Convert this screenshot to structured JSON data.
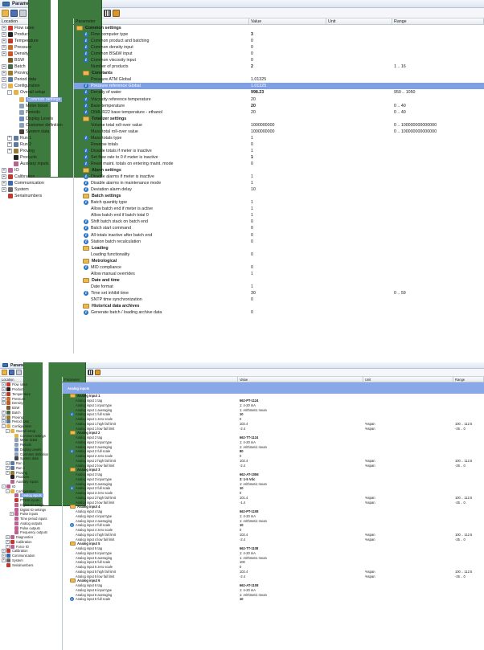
{
  "window": {
    "title": "Parameters"
  },
  "columns": {
    "location": "Location",
    "parameter": "Parameter",
    "value": "Value",
    "unit": "Unit",
    "range": "Range"
  },
  "toolbar": [
    "folder-open-icon",
    "save-icon",
    "print-icon",
    "tree-view-icon",
    "columns-icon",
    "filter-icon"
  ],
  "tree1": [
    {
      "label": "Flow rates",
      "lvl": 0,
      "exp": "+",
      "icon": "#d43a2f"
    },
    {
      "label": "Product",
      "lvl": 0,
      "exp": "+",
      "icon": "#222222"
    },
    {
      "label": "Temperature",
      "lvl": 0,
      "exp": "+",
      "icon": "#c0392b"
    },
    {
      "label": "Pressure",
      "lvl": 0,
      "exp": "+",
      "icon": "#c66f2b"
    },
    {
      "label": "Density",
      "lvl": 0,
      "exp": "+",
      "icon": "#c45a2a"
    },
    {
      "label": "BSW",
      "lvl": 0,
      "exp": "",
      "icon": "#7a5a2a"
    },
    {
      "label": "Batch",
      "lvl": 0,
      "exp": "+",
      "icon": "#4a6a4a"
    },
    {
      "label": "Proving",
      "lvl": 0,
      "exp": "+",
      "icon": "#9a7a30"
    },
    {
      "label": "Period data",
      "lvl": 0,
      "exp": "+",
      "icon": "#5a7a9a"
    },
    {
      "label": "Configuration",
      "lvl": 0,
      "exp": "-",
      "icon": "#e5b24a"
    },
    {
      "label": "Overall setup",
      "lvl": 1,
      "exp": "-",
      "icon": "#e5b24a"
    },
    {
      "label": "Common settings",
      "lvl": 2,
      "exp": "",
      "icon": "#e5b24a",
      "sel": true
    },
    {
      "label": "Meter ticket",
      "lvl": 2,
      "exp": "",
      "icon": "#8aa0b8"
    },
    {
      "label": "Periods",
      "lvl": 2,
      "exp": "",
      "icon": "#8aa0b8"
    },
    {
      "label": "Display Levels",
      "lvl": 2,
      "exp": "",
      "icon": "#6a8ac0"
    },
    {
      "label": "Customer definition",
      "lvl": 2,
      "exp": "",
      "icon": "#8aa0b8"
    },
    {
      "label": "System data",
      "lvl": 2,
      "exp": "",
      "icon": "#444444"
    },
    {
      "label": "Run 1",
      "lvl": 1,
      "exp": "+",
      "icon": "#5a7aa0"
    },
    {
      "label": "Run 2",
      "lvl": 1,
      "exp": "+",
      "icon": "#5a7aa0"
    },
    {
      "label": "Proving",
      "lvl": 1,
      "exp": "+",
      "icon": "#9a7a30"
    },
    {
      "label": "Products",
      "lvl": 1,
      "exp": "",
      "icon": "#222222"
    },
    {
      "label": "Auxiliary inputs",
      "lvl": 1,
      "exp": "",
      "icon": "#c06090"
    },
    {
      "label": "IO",
      "lvl": 0,
      "exp": "+",
      "icon": "#c06090"
    },
    {
      "label": "Calibration",
      "lvl": 0,
      "exp": "+",
      "icon": "#c0392b"
    },
    {
      "label": "Communication",
      "lvl": 0,
      "exp": "+",
      "icon": "#3a6ab0"
    },
    {
      "label": "System",
      "lvl": 0,
      "exp": "+",
      "icon": "#666666"
    },
    {
      "label": "Serialnumbers",
      "lvl": 0,
      "exp": "",
      "icon": "#c0392b"
    }
  ],
  "rows1": [
    {
      "t": "banner1",
      "p": "Common settings"
    },
    {
      "t": "i",
      "p": "Flow computer type",
      "v": "3",
      "b": true
    },
    {
      "t": "i",
      "p": "Common product and batching",
      "v": "0"
    },
    {
      "t": "i",
      "p": "Common density input",
      "v": "0"
    },
    {
      "t": "i",
      "p": "Common BS&W input",
      "v": "0"
    },
    {
      "t": "i",
      "p": "Common viscosity input",
      "v": "0"
    },
    {
      "t": "n",
      "p": "Number of products",
      "v": "2",
      "b": true,
      "r": "1 .. 16"
    },
    {
      "t": "s",
      "p": "Constants"
    },
    {
      "t": "n",
      "p": "Pressure ATM Global",
      "v": "1.01325"
    },
    {
      "t": "i",
      "p": "Pressure reference Global",
      "v": "1.01325",
      "sel": true
    },
    {
      "t": "i",
      "p": "Density of water",
      "v": "998.23",
      "b": true,
      "r": "950 .. 1050"
    },
    {
      "t": "i",
      "p": "Viscosity reference temperature",
      "v": "20"
    },
    {
      "t": "i",
      "p": "Base temperature",
      "v": "20",
      "b": true,
      "r": "0 .. 40"
    },
    {
      "t": "i",
      "p": "OIML R22 base temperature - ethanol",
      "v": "20",
      "r": "0 .. 40"
    },
    {
      "t": "s",
      "p": "Totalizer settings"
    },
    {
      "t": "n",
      "p": "Volume total roll-over value",
      "v": "1000000000",
      "r": "0 .. 100000000000000"
    },
    {
      "t": "n",
      "p": "Mass total roll-over value",
      "v": "1000000000",
      "r": "0 .. 100000000000000"
    },
    {
      "t": "i",
      "p": "Mass totals type",
      "v": "1"
    },
    {
      "t": "n",
      "p": "Reverse totals",
      "v": "0"
    },
    {
      "t": "i",
      "p": "Disable totals if meter is inactive",
      "v": "1"
    },
    {
      "t": "i",
      "p": "Set flow rate to 0 if meter is inactive",
      "v": "1",
      "b": true
    },
    {
      "t": "i",
      "p": "Reset maint. totals on entering maint. mode",
      "v": "0"
    },
    {
      "t": "s",
      "p": "Alarm settings"
    },
    {
      "t": "i",
      "p": "Disable alarms if meter is inactive",
      "v": "1"
    },
    {
      "t": "i",
      "p": "Disable alarms in maintenance mode",
      "v": "1"
    },
    {
      "t": "i",
      "p": "Deviation alarm delay",
      "v": "10"
    },
    {
      "t": "s",
      "p": "Batch settings"
    },
    {
      "t": "i",
      "p": "Batch quantity type",
      "v": "1"
    },
    {
      "t": "n",
      "p": "Allow batch end if meter is active",
      "v": "1"
    },
    {
      "t": "n",
      "p": "Allow batch end if batch total 0",
      "v": "1"
    },
    {
      "t": "i",
      "p": "Shift batch stack on batch end",
      "v": "0"
    },
    {
      "t": "i",
      "p": "Batch start command",
      "v": "0"
    },
    {
      "t": "i",
      "p": "All totals inactive after batch end",
      "v": "0"
    },
    {
      "t": "i",
      "p": "Station batch recalculation",
      "v": "0"
    },
    {
      "t": "s",
      "p": "Loading"
    },
    {
      "t": "n",
      "p": "Loading functionality",
      "v": "0"
    },
    {
      "t": "s",
      "p": "Metrological"
    },
    {
      "t": "i",
      "p": "MID compliance",
      "v": "0"
    },
    {
      "t": "n",
      "p": "Allow manual overrides",
      "v": "1"
    },
    {
      "t": "s",
      "p": "Date and time"
    },
    {
      "t": "n",
      "p": "Date format",
      "v": "1"
    },
    {
      "t": "i",
      "p": "Time set inhibit time",
      "v": "30",
      "r": "0 .. 59"
    },
    {
      "t": "n",
      "p": "SNTP time synchronization",
      "v": "0"
    },
    {
      "t": "s",
      "p": "Historical data archives"
    },
    {
      "t": "i",
      "p": "Generate batch / loading archive data",
      "v": "0"
    }
  ],
  "tree2": [
    {
      "label": "Flow rates",
      "lvl": 0,
      "exp": "+",
      "icon": "#d43a2f"
    },
    {
      "label": "Product",
      "lvl": 0,
      "exp": "+",
      "icon": "#222222"
    },
    {
      "label": "Temperature",
      "lvl": 0,
      "exp": "+",
      "icon": "#c0392b"
    },
    {
      "label": "Pressure",
      "lvl": 0,
      "exp": "+",
      "icon": "#c66f2b"
    },
    {
      "label": "Density",
      "lvl": 0,
      "exp": "+",
      "icon": "#c45a2a"
    },
    {
      "label": "BSW",
      "lvl": 0,
      "exp": "",
      "icon": "#7a5a2a"
    },
    {
      "label": "Batch",
      "lvl": 0,
      "exp": "+",
      "icon": "#4a6a4a"
    },
    {
      "label": "Proving",
      "lvl": 0,
      "exp": "+",
      "icon": "#9a7a30"
    },
    {
      "label": "Period data",
      "lvl": 0,
      "exp": "+",
      "icon": "#5a7a9a"
    },
    {
      "label": "Configuration",
      "lvl": 0,
      "exp": "-",
      "icon": "#e5b24a"
    },
    {
      "label": "Overall setup",
      "lvl": 1,
      "exp": "-",
      "icon": "#e5b24a"
    },
    {
      "label": "Common settings",
      "lvl": 2,
      "exp": "",
      "icon": "#e5b24a"
    },
    {
      "label": "Meter ticket",
      "lvl": 2,
      "exp": "",
      "icon": "#8aa0b8"
    },
    {
      "label": "Periods",
      "lvl": 2,
      "exp": "",
      "icon": "#8aa0b8"
    },
    {
      "label": "Display Levels",
      "lvl": 2,
      "exp": "",
      "icon": "#6a8ac0"
    },
    {
      "label": "Customer definition",
      "lvl": 2,
      "exp": "",
      "icon": "#8aa0b8"
    },
    {
      "label": "System data",
      "lvl": 2,
      "exp": "",
      "icon": "#444444"
    },
    {
      "label": "Run 1",
      "lvl": 1,
      "exp": "+",
      "icon": "#5a7aa0"
    },
    {
      "label": "Run 2",
      "lvl": 1,
      "exp": "+",
      "icon": "#5a7aa0"
    },
    {
      "label": "Proving",
      "lvl": 1,
      "exp": "+",
      "icon": "#9a7a30"
    },
    {
      "label": "Products",
      "lvl": 1,
      "exp": "",
      "icon": "#222222"
    },
    {
      "label": "Auxiliary inputs",
      "lvl": 1,
      "exp": "",
      "icon": "#c06090"
    },
    {
      "label": "IO",
      "lvl": 0,
      "exp": "-",
      "icon": "#c06090"
    },
    {
      "label": "Configuration",
      "lvl": 1,
      "exp": "-",
      "icon": "#e5b24a"
    },
    {
      "label": "Analog inputs",
      "lvl": 2,
      "exp": "",
      "icon": "#c06090",
      "sel": true
    },
    {
      "label": "PT100 inputs",
      "lvl": 2,
      "exp": "",
      "icon": "#c0392b"
    },
    {
      "label": "Digital IO assign",
      "lvl": 2,
      "exp": "",
      "icon": "#c06090"
    },
    {
      "label": "Digital IO settings",
      "lvl": 2,
      "exp": "",
      "icon": "#c06090"
    },
    {
      "label": "Pulse inputs",
      "lvl": 2,
      "exp": "+",
      "icon": "#c06090"
    },
    {
      "label": "Time period inputs",
      "lvl": 2,
      "exp": "",
      "icon": "#c06090"
    },
    {
      "label": "Analog outputs",
      "lvl": 2,
      "exp": "",
      "icon": "#c06090"
    },
    {
      "label": "Pulse outputs",
      "lvl": 2,
      "exp": "",
      "icon": "#c06090"
    },
    {
      "label": "Frequency outputs",
      "lvl": 2,
      "exp": "",
      "icon": "#c06090"
    },
    {
      "label": "Diagnostics",
      "lvl": 1,
      "exp": "+",
      "icon": "#c06090"
    },
    {
      "label": "Calibration",
      "lvl": 1,
      "exp": "+",
      "icon": "#c0392b"
    },
    {
      "label": "Force IO",
      "lvl": 1,
      "exp": "+",
      "icon": "#c06090"
    },
    {
      "label": "Calibration",
      "lvl": 0,
      "exp": "+",
      "icon": "#c0392b"
    },
    {
      "label": "Communication",
      "lvl": 0,
      "exp": "+",
      "icon": "#3a6ab0"
    },
    {
      "label": "System",
      "lvl": 0,
      "exp": "+",
      "icon": "#666666"
    },
    {
      "label": "Serialnumbers",
      "lvl": 0,
      "exp": "",
      "icon": "#c0392b"
    }
  ],
  "rows2": [
    {
      "t": "banner",
      "p": "Analog inputs"
    },
    {
      "t": "s",
      "p": "Analog input 1"
    },
    {
      "t": "n",
      "p": "Analog input 1 tag",
      "v": "662-PT-1124",
      "b": true
    },
    {
      "t": "n",
      "p": "Analog input 1 input type",
      "v": "1: 4-20 mA"
    },
    {
      "t": "n",
      "p": "Analog input 1 averaging",
      "v": "1: Arithmetic mean"
    },
    {
      "t": "i",
      "p": "Analog input 1 full scale",
      "v": "10",
      "b": true
    },
    {
      "t": "n",
      "p": "Analog input 1 zero scale",
      "v": "0"
    },
    {
      "t": "n",
      "p": "Analog input 1 high fail limit",
      "v": "102.4",
      "u": "%span",
      "r": "100 .. 112.5"
    },
    {
      "t": "n",
      "p": "Analog input 1 low fail limit",
      "v": "-2.4",
      "u": "%span",
      "r": "-25 .. 0"
    },
    {
      "t": "s",
      "p": "Analog input 2"
    },
    {
      "t": "n",
      "p": "Analog input 2 tag",
      "v": "662-TT-1124",
      "b": true
    },
    {
      "t": "n",
      "p": "Analog input 2 input type",
      "v": "1: 4-20 mA"
    },
    {
      "t": "n",
      "p": "Analog input 2 averaging",
      "v": "1: Arithmetic mean"
    },
    {
      "t": "i",
      "p": "Analog input 2 full scale",
      "v": "80",
      "b": true
    },
    {
      "t": "n",
      "p": "Analog input 2 zero scale",
      "v": "0"
    },
    {
      "t": "n",
      "p": "Analog input 2 high fail limit",
      "v": "102.4",
      "u": "%span",
      "r": "100 .. 112.5"
    },
    {
      "t": "n",
      "p": "Analog input 2 low fail limit",
      "v": "-2.4",
      "u": "%span",
      "r": "-25 .. 0"
    },
    {
      "t": "s",
      "p": "Analog input 3"
    },
    {
      "t": "n",
      "p": "Analog input 3 tag",
      "v": "662-AT-1086",
      "b": true
    },
    {
      "t": "n",
      "p": "Analog input 3 input type",
      "v": "3: 1-5 Vdc",
      "b": true
    },
    {
      "t": "n",
      "p": "Analog input 3 averaging",
      "v": "1: Arithmetic mean"
    },
    {
      "t": "i",
      "p": "Analog input 3 full scale",
      "v": "10",
      "b": true
    },
    {
      "t": "n",
      "p": "Analog input 3 zero scale",
      "v": "0"
    },
    {
      "t": "n",
      "p": "Analog input 3 high fail limit",
      "v": "101.4",
      "u": "%span",
      "r": "100 .. 112.5"
    },
    {
      "t": "n",
      "p": "Analog input 3 low fail limit",
      "v": "-1.4",
      "u": "%span",
      "r": "-25 .. 0"
    },
    {
      "t": "s",
      "p": "Analog input 4"
    },
    {
      "t": "n",
      "p": "Analog input 4 tag",
      "v": "662-PT-1108",
      "b": true
    },
    {
      "t": "n",
      "p": "Analog input 4 input type",
      "v": "1: 4-20 mA"
    },
    {
      "t": "n",
      "p": "Analog input 4 averaging",
      "v": "1: Arithmetic mean"
    },
    {
      "t": "i",
      "p": "Analog input 4 full scale",
      "v": "10",
      "b": true
    },
    {
      "t": "n",
      "p": "Analog input 4 zero scale",
      "v": "0"
    },
    {
      "t": "n",
      "p": "Analog input 4 high fail limit",
      "v": "102.4",
      "u": "%span",
      "r": "100 .. 112.5"
    },
    {
      "t": "n",
      "p": "Analog input 4 low fail limit",
      "v": "-2.4",
      "u": "%span",
      "r": "-25 .. 0"
    },
    {
      "t": "s",
      "p": "Analog input 5"
    },
    {
      "t": "n",
      "p": "Analog input 5 tag",
      "v": "662-TT-1108",
      "b": true
    },
    {
      "t": "n",
      "p": "Analog input 5 input type",
      "v": "1: 4-20 mA"
    },
    {
      "t": "n",
      "p": "Analog input 5 averaging",
      "v": "1: Arithmetic mean"
    },
    {
      "t": "n",
      "p": "Analog input 5 full scale",
      "v": "100"
    },
    {
      "t": "n",
      "p": "Analog input 5 zero scale",
      "v": "0"
    },
    {
      "t": "n",
      "p": "Analog input 5 high fail limit",
      "v": "102.4",
      "u": "%span",
      "r": "100 .. 112.5"
    },
    {
      "t": "n",
      "p": "Analog input 5 low fail limit",
      "v": "-2.4",
      "u": "%span",
      "r": "-25 .. 0"
    },
    {
      "t": "s",
      "p": "Analog input 6"
    },
    {
      "t": "n",
      "p": "Analog input 6 tag",
      "v": "662-AT-1108",
      "b": true
    },
    {
      "t": "n",
      "p": "Analog input 6 input type",
      "v": "1: 4-20 mA"
    },
    {
      "t": "n",
      "p": "Analog input 6 averaging",
      "v": "1: Arithmetic mean"
    },
    {
      "t": "i",
      "p": "Analog input 6 full scale",
      "v": "10",
      "b": true
    }
  ]
}
